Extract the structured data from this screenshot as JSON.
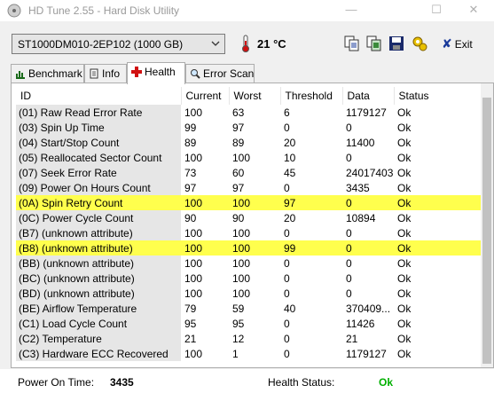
{
  "window": {
    "title": "HD Tune 2.55 - Hard Disk Utility",
    "minimize": "—",
    "maximize": "☐",
    "close": "✕"
  },
  "toolbar": {
    "drive": "ST1000DM010-2EP102 (1000 GB)",
    "temperature": "21 °C",
    "exit_label": "Exit",
    "icons": [
      "copy-text-icon",
      "copy-screenshot-icon",
      "save-icon",
      "options-icon"
    ]
  },
  "tabs": [
    {
      "label": "Benchmark",
      "icon": "benchmark-icon"
    },
    {
      "label": "Info",
      "icon": "info-icon"
    },
    {
      "label": "Health",
      "icon": "health-cross-icon",
      "active": true
    },
    {
      "label": "Error Scan",
      "icon": "magnifier-icon"
    }
  ],
  "table": {
    "headers": [
      "ID",
      "Current",
      "Worst",
      "Threshold",
      "Data",
      "Status"
    ],
    "highlight_color": "#ffff4d",
    "rows": [
      {
        "id": "(01) Raw Read Error Rate",
        "current": "100",
        "worst": "63",
        "threshold": "6",
        "data": "1179127",
        "status": "Ok",
        "hl": false
      },
      {
        "id": "(03) Spin Up Time",
        "current": "99",
        "worst": "97",
        "threshold": "0",
        "data": "0",
        "status": "Ok",
        "hl": false
      },
      {
        "id": "(04) Start/Stop Count",
        "current": "89",
        "worst": "89",
        "threshold": "20",
        "data": "11400",
        "status": "Ok",
        "hl": false
      },
      {
        "id": "(05) Reallocated Sector Count",
        "current": "100",
        "worst": "100",
        "threshold": "10",
        "data": "0",
        "status": "Ok",
        "hl": false
      },
      {
        "id": "(07) Seek Error Rate",
        "current": "73",
        "worst": "60",
        "threshold": "45",
        "data": "24017403",
        "status": "Ok",
        "hl": false
      },
      {
        "id": "(09) Power On Hours Count",
        "current": "97",
        "worst": "97",
        "threshold": "0",
        "data": "3435",
        "status": "Ok",
        "hl": false
      },
      {
        "id": "(0A) Spin Retry Count",
        "current": "100",
        "worst": "100",
        "threshold": "97",
        "data": "0",
        "status": "Ok",
        "hl": true
      },
      {
        "id": "(0C) Power Cycle Count",
        "current": "90",
        "worst": "90",
        "threshold": "20",
        "data": "10894",
        "status": "Ok",
        "hl": false
      },
      {
        "id": "(B7) (unknown attribute)",
        "current": "100",
        "worst": "100",
        "threshold": "0",
        "data": "0",
        "status": "Ok",
        "hl": false
      },
      {
        "id": "(B8) (unknown attribute)",
        "current": "100",
        "worst": "100",
        "threshold": "99",
        "data": "0",
        "status": "Ok",
        "hl": true
      },
      {
        "id": "(BB) (unknown attribute)",
        "current": "100",
        "worst": "100",
        "threshold": "0",
        "data": "0",
        "status": "Ok",
        "hl": false
      },
      {
        "id": "(BC) (unknown attribute)",
        "current": "100",
        "worst": "100",
        "threshold": "0",
        "data": "0",
        "status": "Ok",
        "hl": false
      },
      {
        "id": "(BD) (unknown attribute)",
        "current": "100",
        "worst": "100",
        "threshold": "0",
        "data": "0",
        "status": "Ok",
        "hl": false
      },
      {
        "id": "(BE) Airflow Temperature",
        "current": "79",
        "worst": "59",
        "threshold": "40",
        "data": "370409...",
        "status": "Ok",
        "hl": false
      },
      {
        "id": "(C1) Load Cycle Count",
        "current": "95",
        "worst": "95",
        "threshold": "0",
        "data": "11426",
        "status": "Ok",
        "hl": false
      },
      {
        "id": "(C2) Temperature",
        "current": "21",
        "worst": "12",
        "threshold": "0",
        "data": "21",
        "status": "Ok",
        "hl": false
      },
      {
        "id": "(C3) Hardware ECC Recovered",
        "current": "100",
        "worst": "1",
        "threshold": "0",
        "data": "1179127",
        "status": "Ok",
        "hl": false
      }
    ]
  },
  "footer": {
    "power_on_label": "Power On Time:",
    "power_on_value": "3435",
    "health_label": "Health Status:",
    "health_value": "Ok",
    "health_color": "#00b000"
  }
}
